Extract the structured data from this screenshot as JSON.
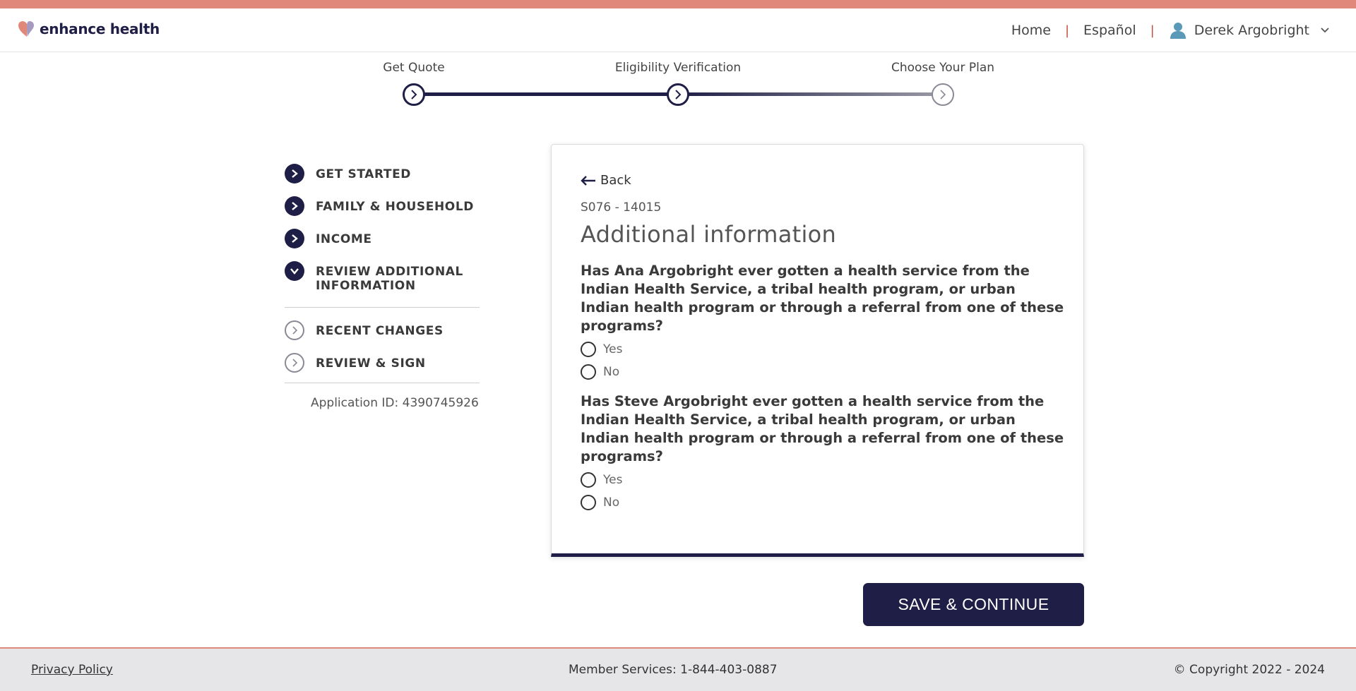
{
  "brand": {
    "name": "enhance health",
    "colors": {
      "navy": "#1e1e46",
      "coral": "#e0897a",
      "grey": "#8a8a96"
    }
  },
  "nav": {
    "home": "Home",
    "language": "Español",
    "user_name": "Derek Argobright",
    "icons": {
      "user": "user-icon",
      "menu": "chevron-down-icon"
    }
  },
  "progress": {
    "steps": [
      {
        "label": "Get Quote",
        "status": "complete"
      },
      {
        "label": "Eligibility Verification",
        "status": "current"
      },
      {
        "label": "Choose Your Plan",
        "status": "upcoming"
      }
    ]
  },
  "sidebar": {
    "items": [
      {
        "label": "GET STARTED",
        "state": "complete",
        "icon": "chevron-right-icon"
      },
      {
        "label": "FAMILY & HOUSEHOLD",
        "state": "complete",
        "icon": "chevron-right-icon"
      },
      {
        "label": "INCOME",
        "state": "complete",
        "icon": "chevron-right-icon"
      },
      {
        "label": "REVIEW ADDITIONAL INFORMATION",
        "state": "current",
        "icon": "chevron-down-icon"
      },
      {
        "label": "RECENT CHANGES",
        "state": "upcoming",
        "icon": "chevron-right-icon"
      },
      {
        "label": "REVIEW & SIGN",
        "state": "upcoming",
        "icon": "chevron-right-icon"
      }
    ],
    "application_id": "Application ID: 4390745926"
  },
  "form": {
    "back_label": "Back",
    "code": "S076 - 14015",
    "title": "Additional information",
    "questions": [
      {
        "text": "Has Ana Argobright ever gotten a health service from the Indian Health Service, a tribal health program, or urban Indian health program or through a referral from one of these programs?",
        "options": [
          "Yes",
          "No"
        ],
        "selected": null
      },
      {
        "text": "Has Steve Argobright ever gotten a health service from the Indian Health Service, a tribal health program, or urban Indian health program or through a referral from one of these programs?",
        "options": [
          "Yes",
          "No"
        ],
        "selected": null
      }
    ]
  },
  "actions": {
    "save_continue": "SAVE & CONTINUE"
  },
  "footer": {
    "privacy": "Privacy Policy",
    "member_services": "Member Services: 1-844-403-0887",
    "copyright": "© Copyright 2022 - 2024"
  }
}
